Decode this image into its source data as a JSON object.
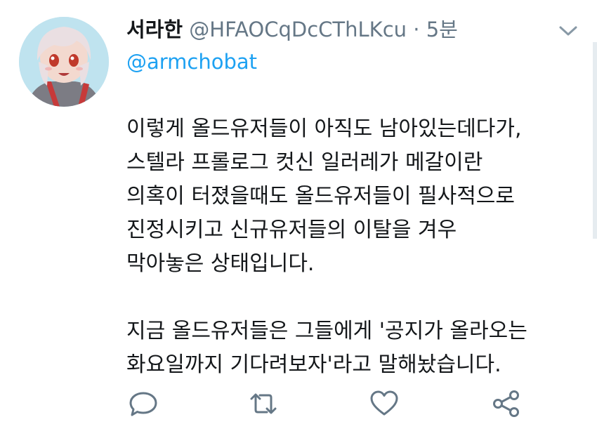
{
  "tweet": {
    "author_name": "서라한",
    "author_handle": "@HFAOCqDcCThLKcu",
    "separator": "·",
    "timestamp": "5분",
    "reply_to": "@armchobat",
    "body_lines": [
      "이렇게 올드유저들이 아직도 남아있는데다가,",
      "스텔라 프롤로그 컷신 일러레가 메갈이란",
      "의혹이 터졌을때도 올드유저들이 필사적으로",
      "진정시키고 신규유저들의 이탈을 겨우",
      "막아놓은 상태입니다."
    ],
    "body_lines_2": [
      "지금 올드유저들은 그들에게 '공지가 올라오는",
      "화요일까지 기다려보자'라고 말해놨습니다."
    ]
  },
  "icons": {
    "menu": "chevron-down-icon",
    "reply": "reply-icon",
    "retweet": "retweet-icon",
    "like": "heart-icon",
    "share": "share-icon"
  },
  "colors": {
    "text": "#14171a",
    "muted": "#657786",
    "link": "#1da1f2"
  }
}
